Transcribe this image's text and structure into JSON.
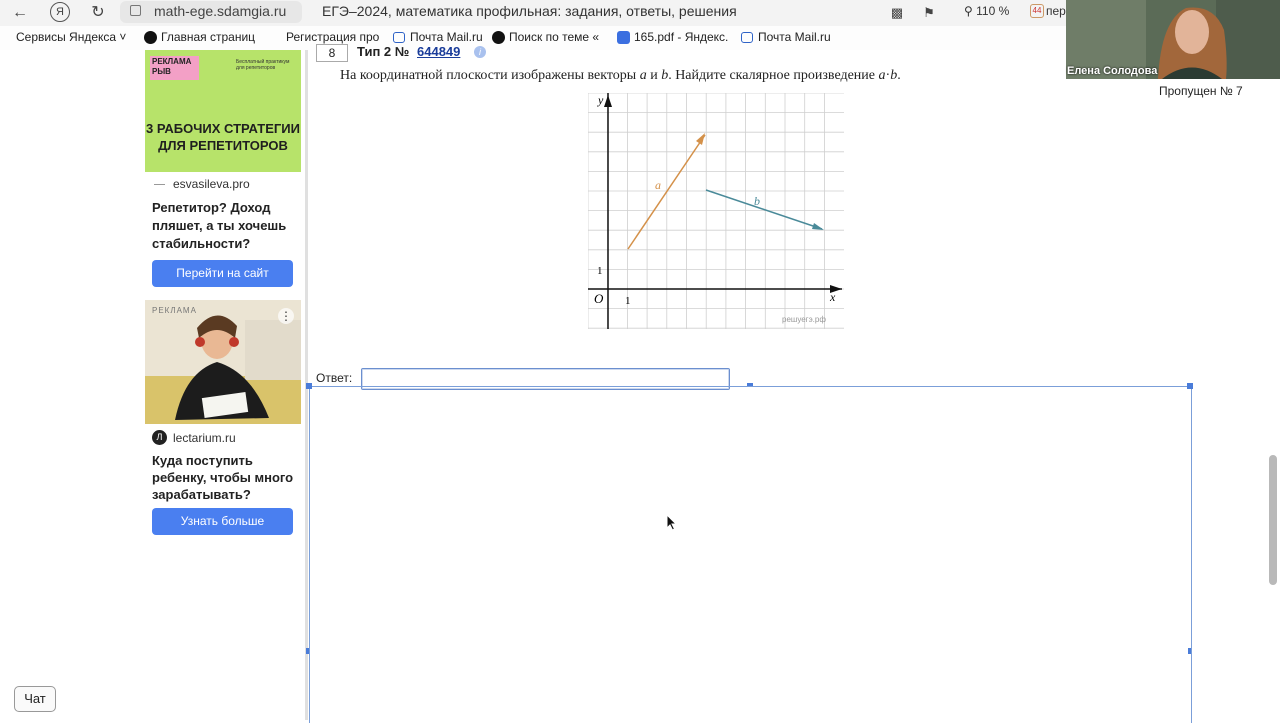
{
  "browser": {
    "url": "math-ege.sdamgia.ru",
    "tab_title": "ЕГЭ–2024, математика профильная: задания, ответы, решения",
    "zoom": "110 %",
    "tabs_count": "44",
    "tabs_label": "пер"
  },
  "bookmarks": [
    {
      "label": "Сервисы Яндекса"
    },
    {
      "label": "Главная страниц"
    },
    {
      "label": "Регистрация про"
    },
    {
      "label": "Почта Mail.ru"
    },
    {
      "label": "Поиск по теме «"
    },
    {
      "label": "165.pdf - Яндекс."
    },
    {
      "label": "Почта Mail.ru"
    }
  ],
  "ads": {
    "ad1": {
      "badge": "РЕКЛАМА РЫВ",
      "small_text": "Бесплатный практикум для репетиторов",
      "headline": "3 РАБОЧИХ СТРАТЕГИИ ДЛЯ РЕПЕТИТОРОВ",
      "domain": "esvasileva.pro",
      "text": "Репетитор? Доход пляшет, а ты хочешь стабильности?",
      "button": "Перейти на сайт"
    },
    "ad2": {
      "label": "РЕКЛАМА",
      "domain": "lectarium.ru",
      "logo": "Л",
      "text": "Куда поступить ребенку, чтобы много зарабатывать?",
      "button": "Узнать больше"
    }
  },
  "task": {
    "number": "8",
    "type_label": "Тип 2 №",
    "id": "644849",
    "info": "i",
    "text_before": "На координатной плоскости изображены векторы ",
    "vec_a": "a",
    "and": " и ",
    "vec_b": "b",
    "text_after": ". Найдите скалярное произведение ",
    "dot": "·",
    "end": "."
  },
  "graph": {
    "y_label": "y",
    "x_label": "x",
    "origin_label": "O",
    "one_x": "1",
    "one_y": "1",
    "vec_a_label": "a",
    "vec_b_label": "b",
    "watermark": "решуегэ.рф",
    "colors": {
      "a": "#d4914a",
      "b": "#4a8a99",
      "grid": "#cfcfcf"
    }
  },
  "answer": {
    "label": "Ответ:",
    "value": ""
  },
  "video": {
    "name": "Елена Солодова"
  },
  "skipped": "Пропущен № 7",
  "chat_button": "Чат"
}
